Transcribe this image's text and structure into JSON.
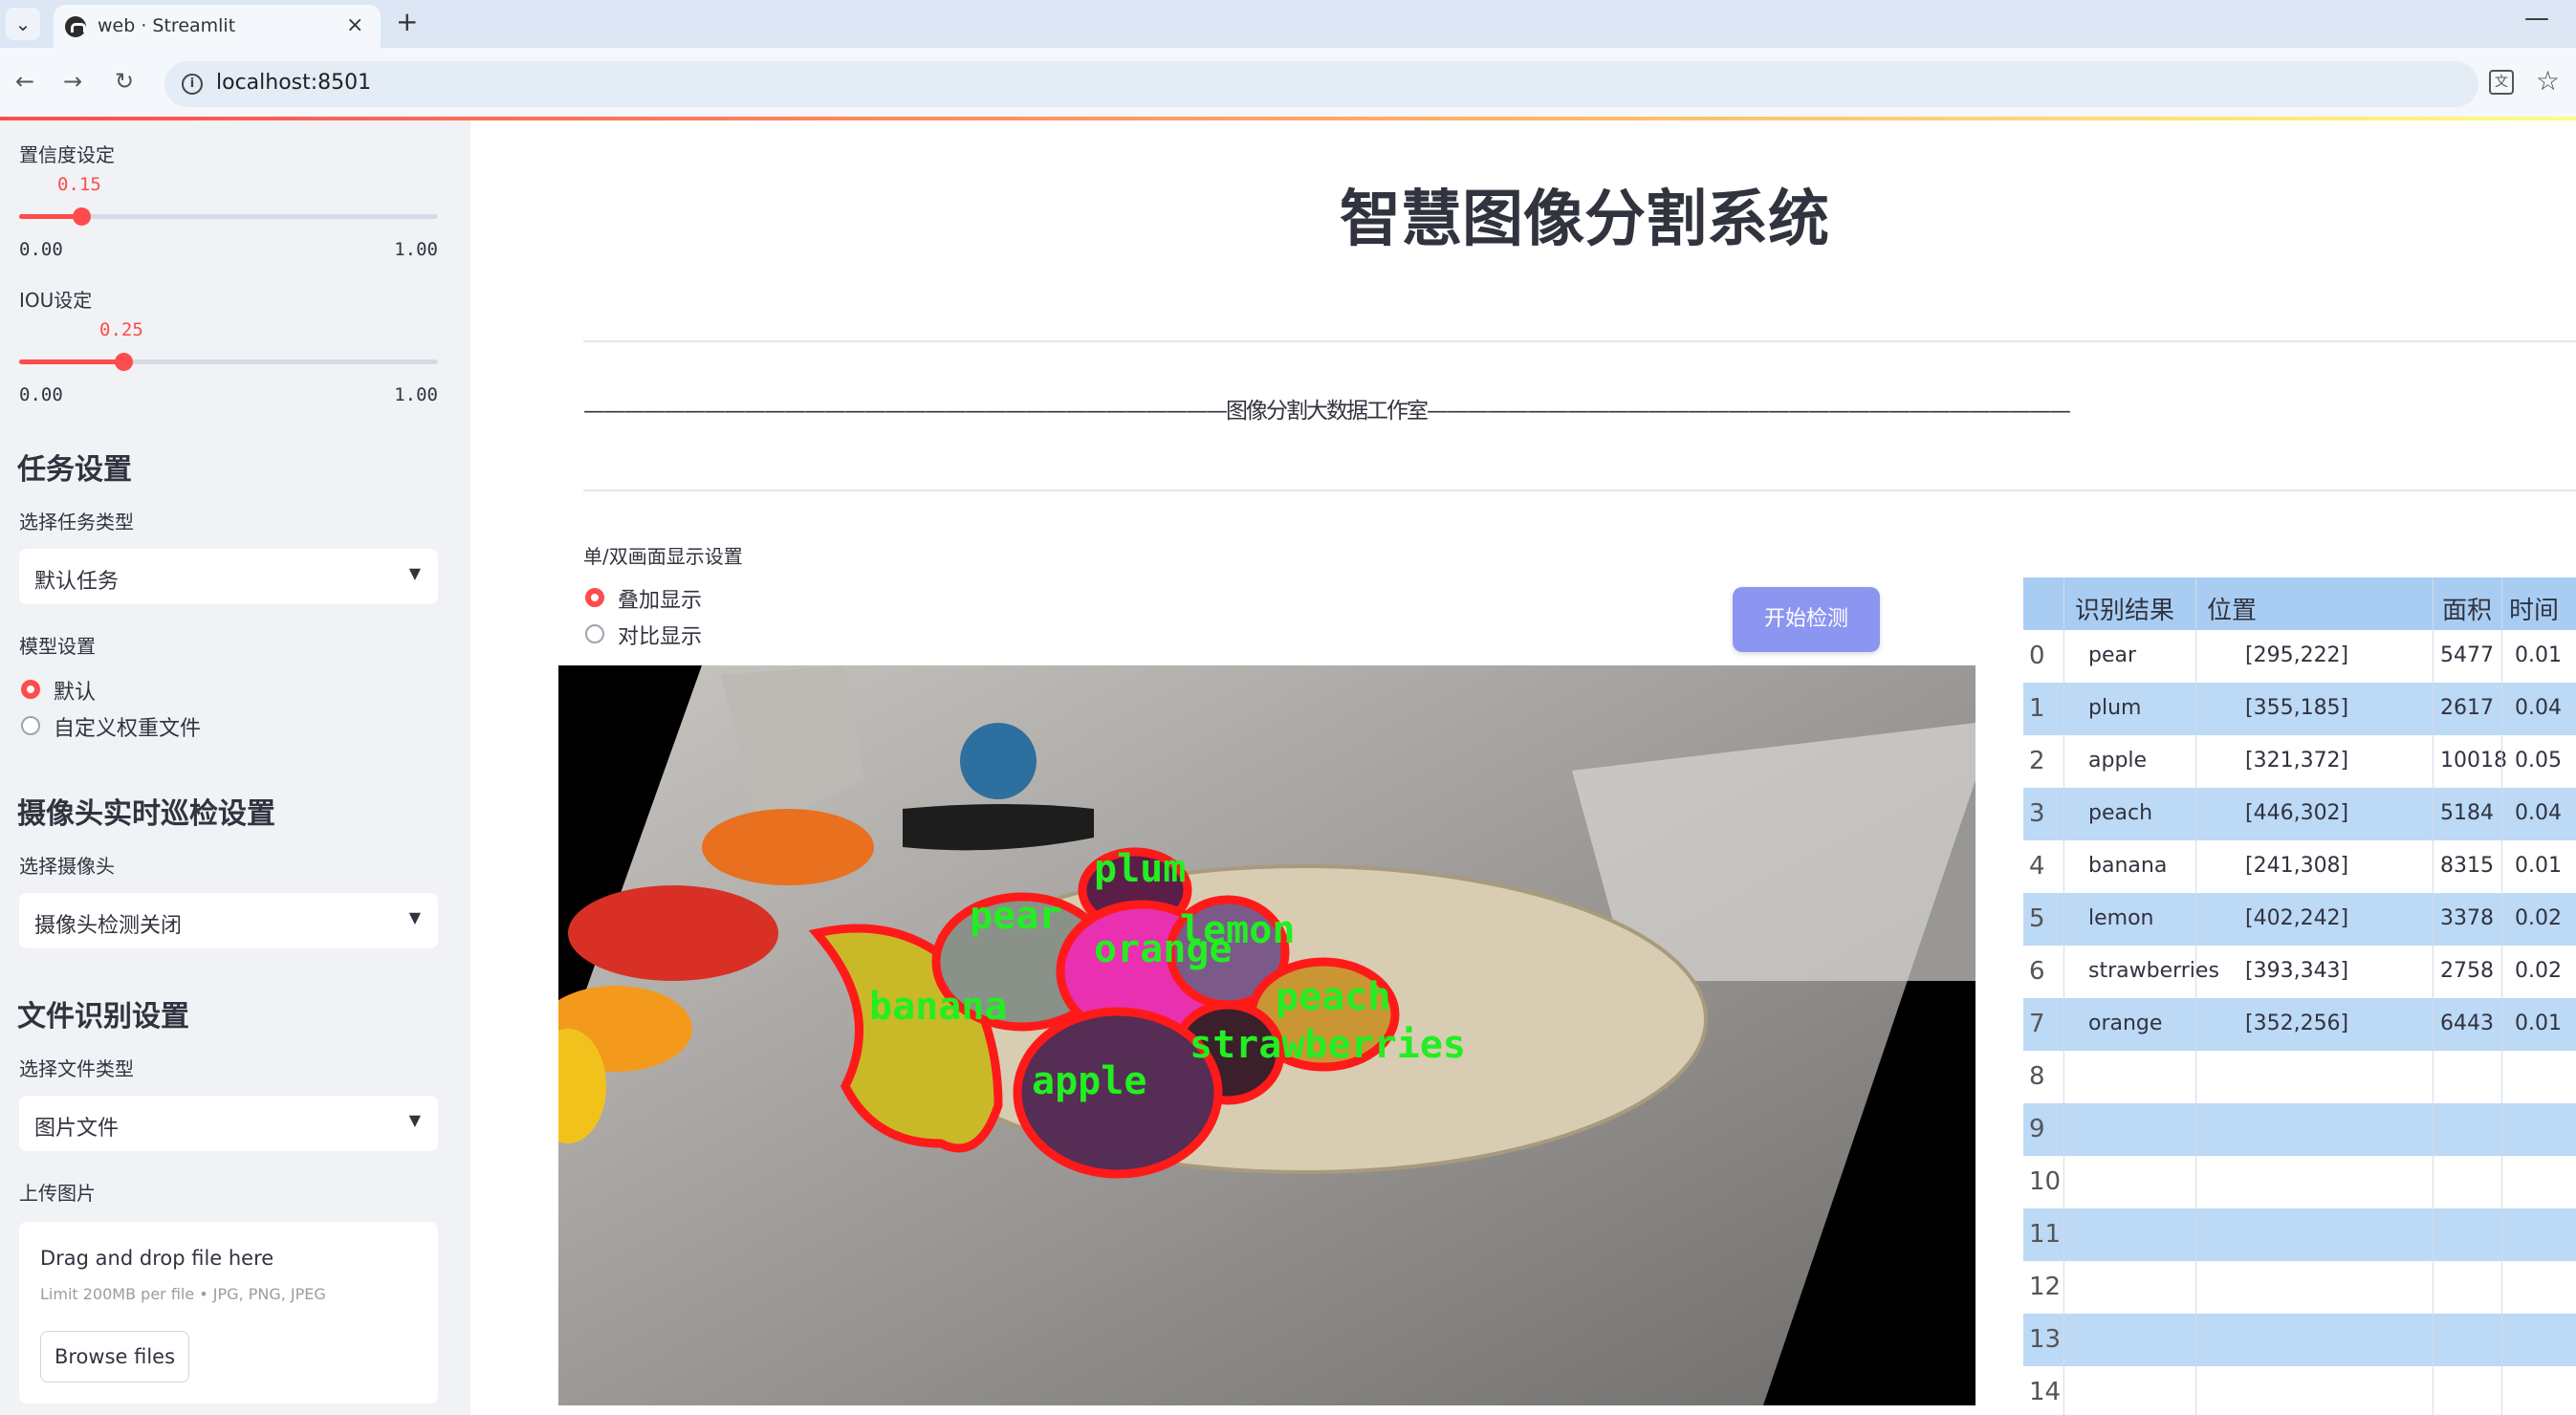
{
  "browser": {
    "tab_title": "web · Streamlit",
    "url": "localhost:8501",
    "tab_close": "×",
    "new_tab": "+",
    "minimize": "—"
  },
  "sidebar": {
    "confidence": {
      "label": "置信度设定",
      "value": "0.15",
      "min": "0.00",
      "max": "1.00",
      "fraction": 0.15
    },
    "iou": {
      "label": "IOU设定",
      "value": "0.25",
      "min": "0.00",
      "max": "1.00",
      "fraction": 0.25
    },
    "task_heading": "任务设置",
    "task_select_label": "选择任务类型",
    "task_select_value": "默认任务",
    "model_label": "模型设置",
    "model_options": [
      "默认",
      "自定义权重文件"
    ],
    "model_selected": "默认",
    "camera_heading": "摄像头实时巡检设置",
    "camera_select_label": "选择摄像头",
    "camera_select_value": "摄像头检测关闭",
    "file_heading": "文件识别设置",
    "file_type_label": "选择文件类型",
    "file_type_value": "图片文件",
    "upload_label": "上传图片",
    "upload_main": "Drag and drop file here",
    "upload_sub": "Limit 200MB per file • JPG, PNG, JPEG",
    "upload_button": "Browse files"
  },
  "main": {
    "title": "智慧图像分割系统",
    "banner": "————————————————————————————————图像分割大数据工作室————————————————————————————————",
    "display_label": "单/双画面显示设置",
    "display_options": [
      "叠加显示",
      "对比显示"
    ],
    "display_selected": "叠加显示",
    "start_button": "开始检测",
    "detections": [
      "plum",
      "pear",
      "lemon",
      "orange",
      "banana",
      "peach",
      "strawberries",
      "apple"
    ]
  },
  "table": {
    "headers": [
      "识别结果",
      "位置",
      "面积",
      "时间"
    ],
    "rows": [
      {
        "i": "0",
        "result": "pear",
        "pos": "[295,222]",
        "area": "5477",
        "time": "0.01"
      },
      {
        "i": "1",
        "result": "plum",
        "pos": "[355,185]",
        "area": "2617",
        "time": "0.04"
      },
      {
        "i": "2",
        "result": "apple",
        "pos": "[321,372]",
        "area": "10018",
        "time": "0.05"
      },
      {
        "i": "3",
        "result": "peach",
        "pos": "[446,302]",
        "area": "5184",
        "time": "0.04"
      },
      {
        "i": "4",
        "result": "banana",
        "pos": "[241,308]",
        "area": "8315",
        "time": "0.01"
      },
      {
        "i": "5",
        "result": "lemon",
        "pos": "[402,242]",
        "area": "3378",
        "time": "0.02"
      },
      {
        "i": "6",
        "result": "strawberries",
        "pos": "[393,343]",
        "area": "2758",
        "time": "0.02"
      },
      {
        "i": "7",
        "result": "orange",
        "pos": "[352,256]",
        "area": "6443",
        "time": "0.01"
      },
      {
        "i": "8",
        "result": "",
        "pos": "",
        "area": "",
        "time": ""
      },
      {
        "i": "9",
        "result": "",
        "pos": "",
        "area": "",
        "time": ""
      },
      {
        "i": "10",
        "result": "",
        "pos": "",
        "area": "",
        "time": ""
      },
      {
        "i": "11",
        "result": "",
        "pos": "",
        "area": "",
        "time": ""
      },
      {
        "i": "12",
        "result": "",
        "pos": "",
        "area": "",
        "time": ""
      },
      {
        "i": "13",
        "result": "",
        "pos": "",
        "area": "",
        "time": ""
      },
      {
        "i": "14",
        "result": "",
        "pos": "",
        "area": "",
        "time": ""
      }
    ]
  },
  "colors": {
    "accent": "#ff4b4b",
    "button": "#8c96f0",
    "sidebar_bg": "#f0f2f6",
    "table_header": "#a9cdf2",
    "table_alt": "#bcd9f6"
  }
}
